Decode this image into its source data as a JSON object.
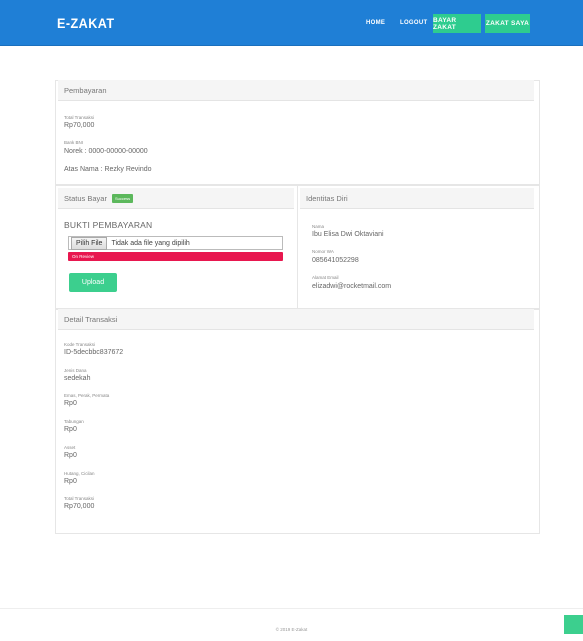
{
  "nav": {
    "brand": "E-ZAKAT",
    "home": "HOME",
    "logout": "LOGOUT",
    "bayar_zakat": "BAYAR ZAKAT",
    "zakat_saya": "ZAKAT SAYA"
  },
  "pembayaran": {
    "header": "Pembayaran",
    "total_label": "Total Transaksi",
    "total_value": "Rp70,000",
    "bank_label": "Bank BNI",
    "norek": "Norek : 0000-00000-00000",
    "atas_nama": "Atas Nama : Rezky Revindo"
  },
  "status": {
    "header": "Status Bayar",
    "badge": "Success",
    "bukti_title": "BUKTI PEMBAYARAN",
    "file_button": "Pilih File",
    "file_text": "Tidak ada file yang dipilih",
    "review": "On Review",
    "upload": "Upload"
  },
  "identitas": {
    "header": "Identitas Diri",
    "nama_label": "Nama",
    "nama_value": "Ibu Elisa Dwi Oktaviani",
    "wa_label": "Nomor WA",
    "wa_value": "085641052298",
    "email_label": "Alamat Email",
    "email_value": "elizadwi@rocketmail.com"
  },
  "detail": {
    "header": "Detail Transaksi",
    "items": [
      {
        "label": "Kode Transaksi",
        "value": "ID-5decbbc837672"
      },
      {
        "label": "Jenis Dana",
        "value": "sedekah"
      },
      {
        "label": "Emas, Perak, Permata",
        "value": "Rp0"
      },
      {
        "label": "Tabungan",
        "value": "Rp0"
      },
      {
        "label": "Asset",
        "value": "Rp0"
      },
      {
        "label": "Hutang, Cicilan",
        "value": "Rp0"
      },
      {
        "label": "Total Transaksi",
        "value": "Rp70,000"
      }
    ]
  },
  "footer": {
    "text": "© 2019 E-Zakat"
  },
  "colors": {
    "nav_bg": "#1f7fd6",
    "accent_green": "#2ecc8f",
    "review_red": "#e8174f",
    "success": "#5cb85c"
  }
}
